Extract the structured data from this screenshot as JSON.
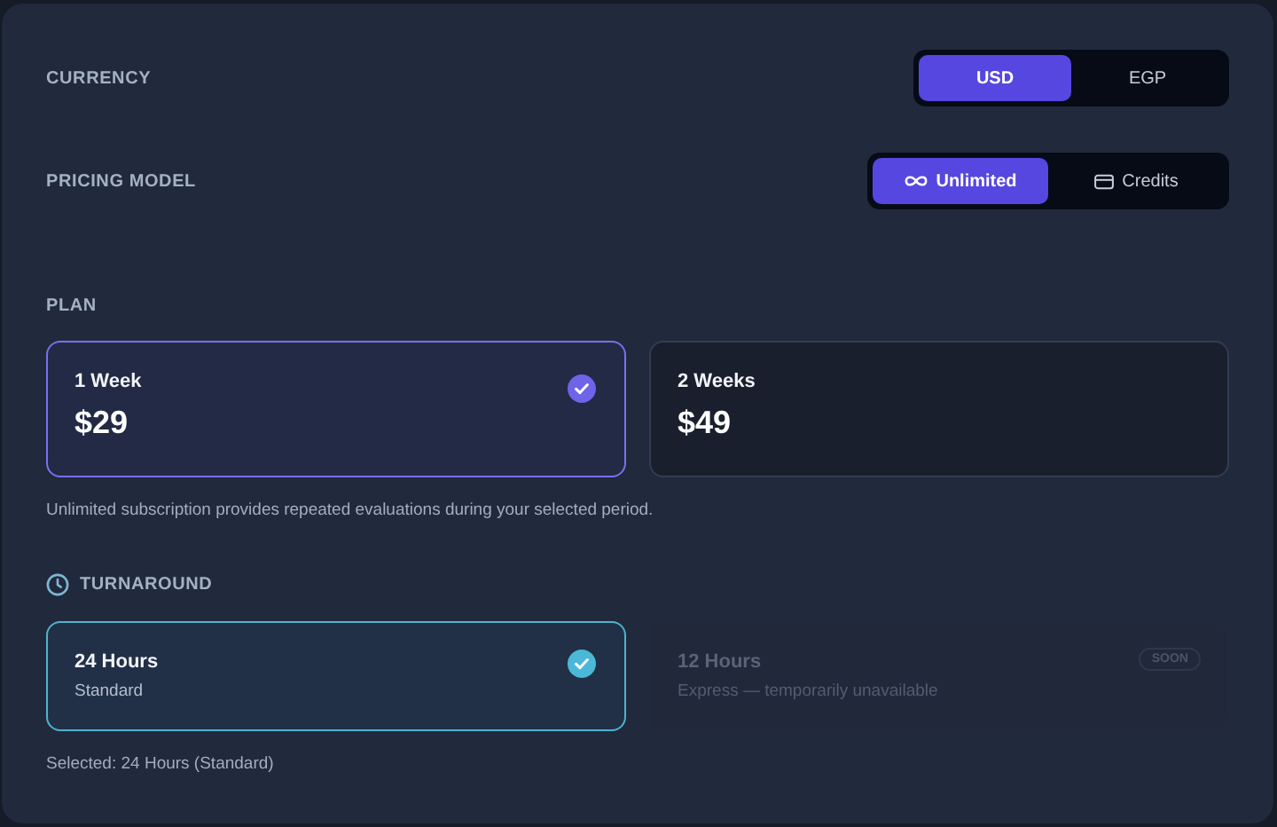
{
  "currency": {
    "label": "CURRENCY",
    "options": [
      {
        "label": "USD",
        "selected": true
      },
      {
        "label": "EGP",
        "selected": false
      }
    ]
  },
  "pricing_model": {
    "label": "PRICING MODEL",
    "options": [
      {
        "label": "Unlimited",
        "kind": "infinity",
        "selected": true
      },
      {
        "label": "Credits",
        "kind": "card",
        "selected": false
      }
    ]
  },
  "plan": {
    "label": "PLAN",
    "options": [
      {
        "name": "1 Week",
        "price": "$29",
        "selected": true
      },
      {
        "name": "2 Weeks",
        "price": "$49",
        "selected": false
      }
    ],
    "note": "Unlimited subscription provides repeated evaluations during your selected period."
  },
  "turnaround": {
    "label": "TURNAROUND",
    "options": [
      {
        "name": "24 Hours",
        "description": "Standard",
        "selected": true,
        "disabled": false
      },
      {
        "name": "12 Hours",
        "description": "Express — temporarily unavailable",
        "selected": false,
        "disabled": true,
        "badge": "SOON"
      }
    ],
    "summary": "Selected: 24 Hours (Standard)"
  }
}
